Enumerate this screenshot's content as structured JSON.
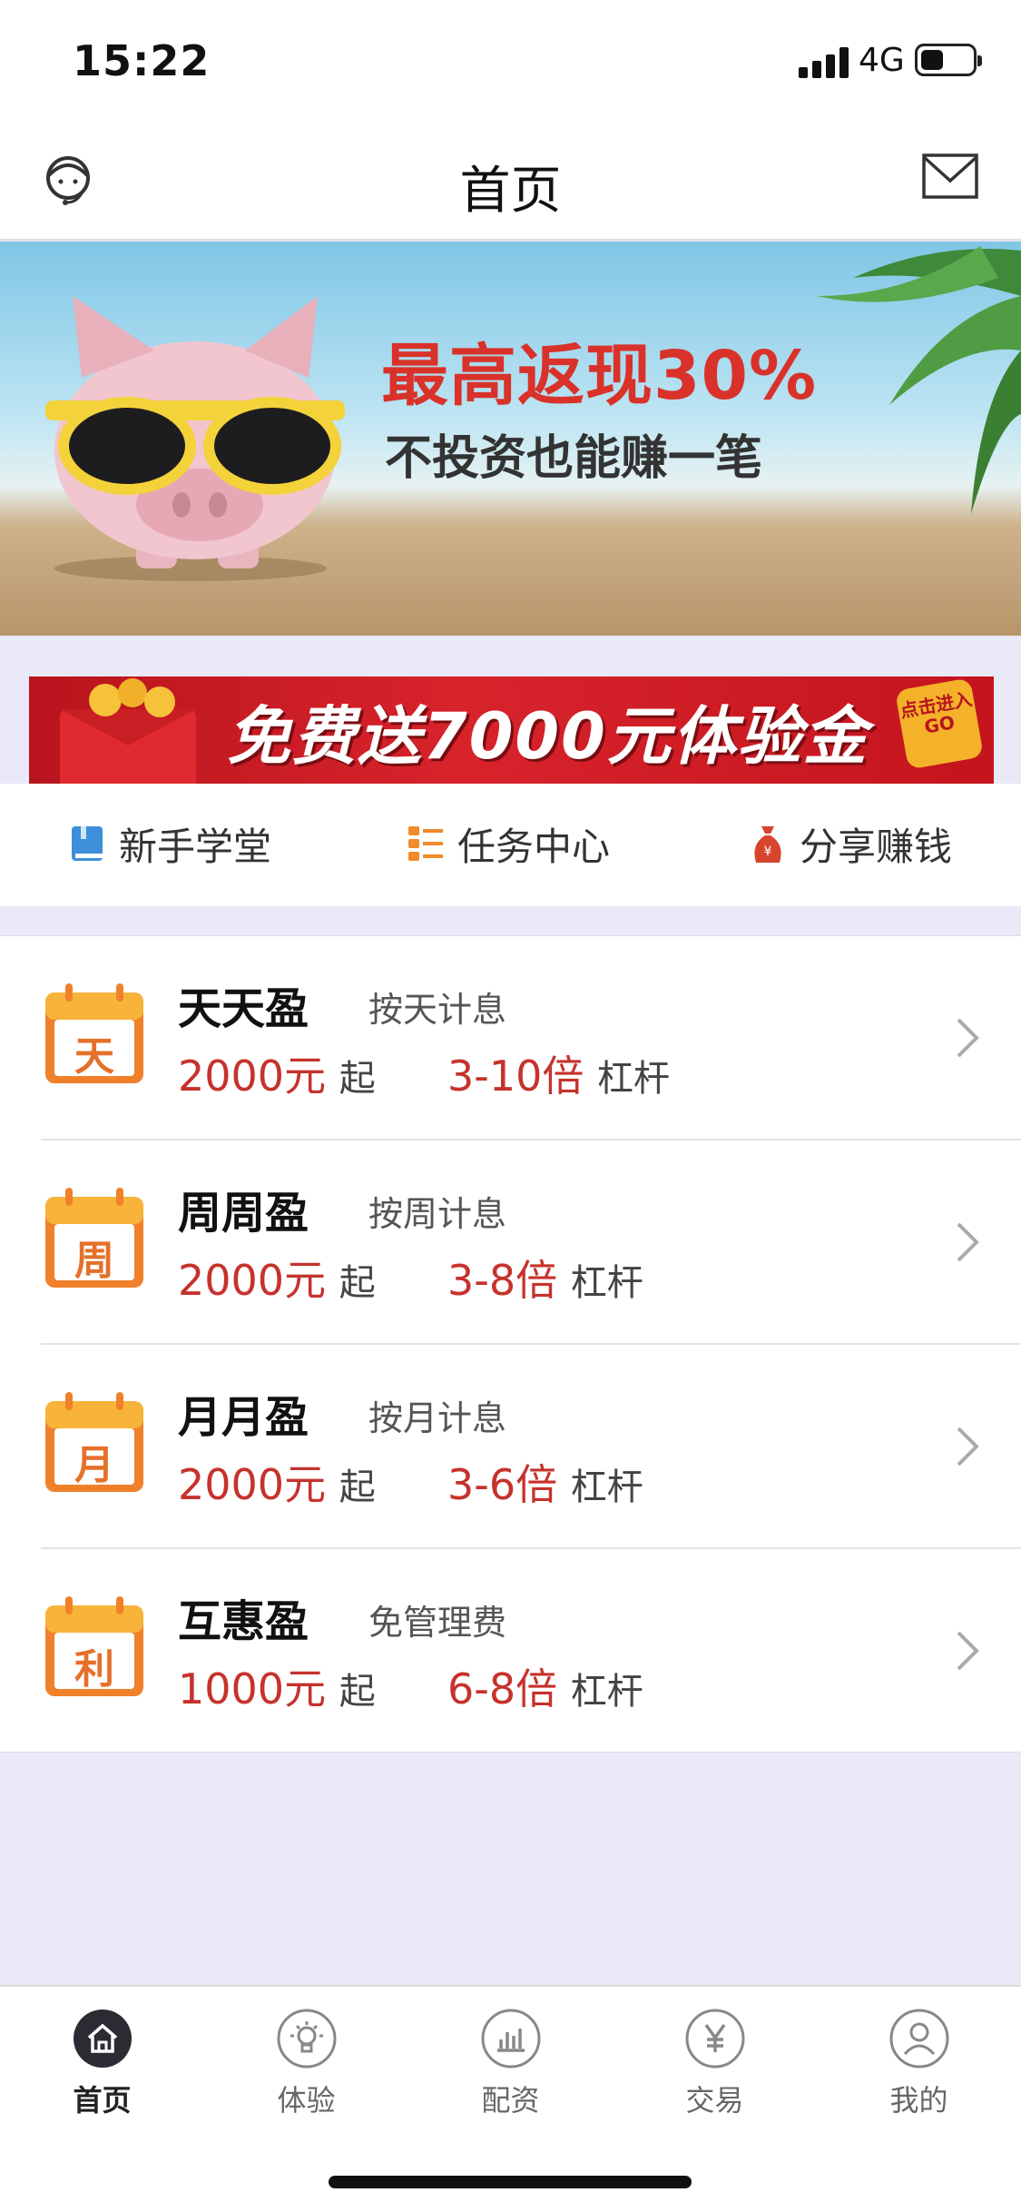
{
  "status": {
    "time": "15:22",
    "network": "4G",
    "battery_level": 0.45
  },
  "nav": {
    "title": "首页",
    "left_icon": "customer-service-icon",
    "right_icon": "mail-icon"
  },
  "banner": {
    "headline": "最高返现30%",
    "subline": "不投资也能赚一笔"
  },
  "promo": {
    "text": "免费送7000元体验金",
    "badge_text": "点击进入GO"
  },
  "quick_links": [
    {
      "label": "新手学堂",
      "icon": "book-icon",
      "color": "#3d8fd9"
    },
    {
      "label": "任务中心",
      "icon": "task-list-icon",
      "color": "#f08a2a"
    },
    {
      "label": "分享赚钱",
      "icon": "money-bag-icon",
      "color": "#d8452f"
    }
  ],
  "products": [
    {
      "badge": "天",
      "name": "天天盈",
      "desc": "按天计息",
      "amount": "2000元",
      "from": "起",
      "leverage": "3-10倍",
      "leverage_label": "杠杆"
    },
    {
      "badge": "周",
      "name": "周周盈",
      "desc": "按周计息",
      "amount": "2000元",
      "from": "起",
      "leverage": "3-8倍",
      "leverage_label": "杠杆"
    },
    {
      "badge": "月",
      "name": "月月盈",
      "desc": "按月计息",
      "amount": "2000元",
      "from": "起",
      "leverage": "3-6倍",
      "leverage_label": "杠杆"
    },
    {
      "badge": "利",
      "name": "互惠盈",
      "desc": "免管理费",
      "amount": "1000元",
      "from": "起",
      "leverage": "6-8倍",
      "leverage_label": "杠杆"
    }
  ],
  "tabs": [
    {
      "label": "首页",
      "icon": "home-icon",
      "active": true
    },
    {
      "label": "体验",
      "icon": "lightbulb-icon",
      "active": false
    },
    {
      "label": "配资",
      "icon": "bar-chart-icon",
      "active": false
    },
    {
      "label": "交易",
      "icon": "yen-icon",
      "active": false
    },
    {
      "label": "我的",
      "icon": "user-icon",
      "active": false
    }
  ],
  "colors": {
    "accent_red": "#c6322d",
    "calendar_orange": "#f0812a",
    "calendar_yellow": "#f7b33a",
    "active_tab": "#2b2b33"
  }
}
